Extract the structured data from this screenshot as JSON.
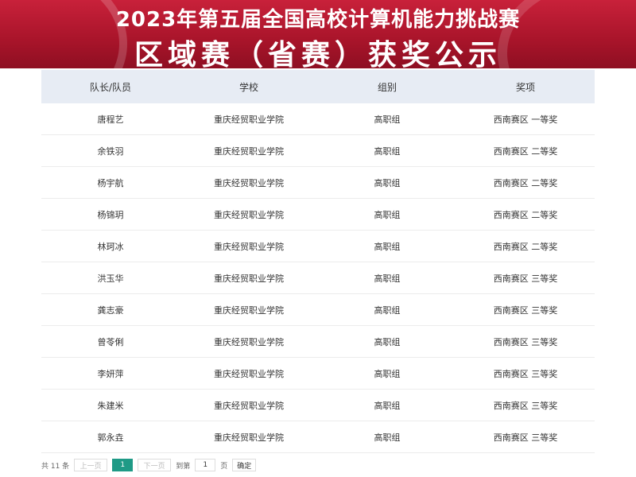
{
  "banner": {
    "line1": "2023年第五届全国高校计算机能力挑战赛",
    "line2": "区域赛（省赛）获奖公示"
  },
  "table": {
    "headers": [
      "队长/队员",
      "学校",
      "组别",
      "奖项"
    ],
    "rows": [
      [
        "唐程艺",
        "重庆经贸职业学院",
        "高职组",
        "西南赛区 一等奖"
      ],
      [
        "余铁羽",
        "重庆经贸职业学院",
        "高职组",
        "西南赛区 二等奖"
      ],
      [
        "杨宇航",
        "重庆经贸职业学院",
        "高职组",
        "西南赛区 二等奖"
      ],
      [
        "杨锦玥",
        "重庆经贸职业学院",
        "高职组",
        "西南赛区 二等奖"
      ],
      [
        "林珂冰",
        "重庆经贸职业学院",
        "高职组",
        "西南赛区 二等奖"
      ],
      [
        "洪玉华",
        "重庆经贸职业学院",
        "高职组",
        "西南赛区 三等奖"
      ],
      [
        "龚志豪",
        "重庆经贸职业学院",
        "高职组",
        "西南赛区 三等奖"
      ],
      [
        "曾苓俐",
        "重庆经贸职业学院",
        "高职组",
        "西南赛区 三等奖"
      ],
      [
        "李妍萍",
        "重庆经贸职业学院",
        "高职组",
        "西南赛区 三等奖"
      ],
      [
        "朱建米",
        "重庆经贸职业学院",
        "高职组",
        "西南赛区 三等奖"
      ],
      [
        "郭永垚",
        "重庆经贸职业学院",
        "高职组",
        "西南赛区 三等奖"
      ]
    ]
  },
  "pager": {
    "total": "共 11 条",
    "prev": "上一页",
    "current": "1",
    "next": "下一页",
    "goto_label": "到第",
    "goto_value": "1",
    "page_unit": "页",
    "confirm": "确定"
  },
  "colors": {
    "banner": "#b0182e",
    "header_bg": "#e7ecf4",
    "pager_active": "#1f9a86"
  }
}
